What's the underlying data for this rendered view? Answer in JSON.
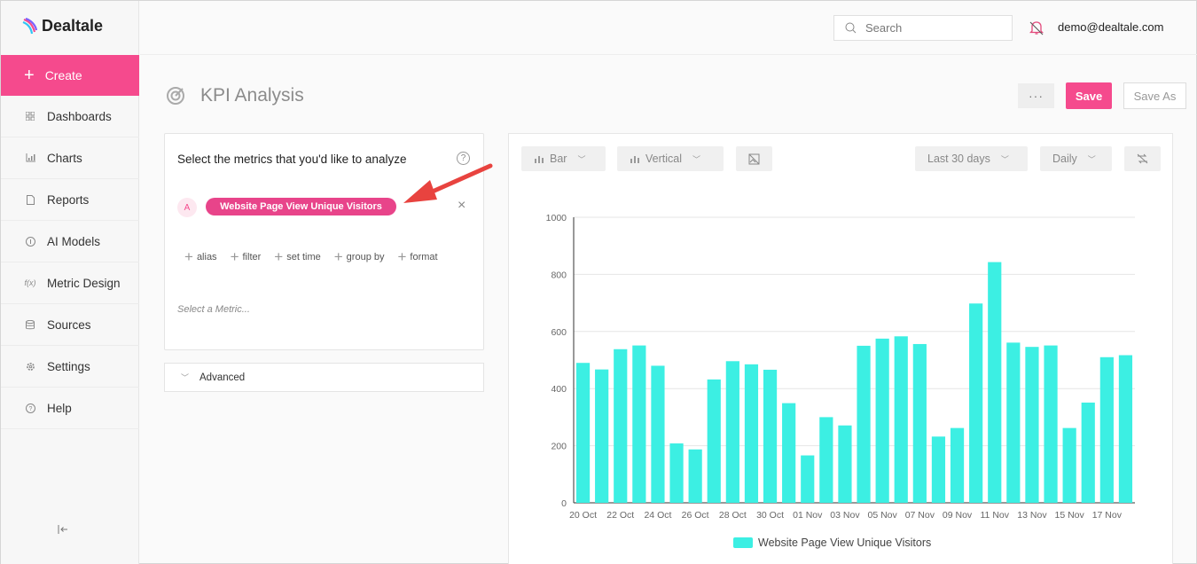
{
  "app": {
    "name": "Dealtale"
  },
  "sidebar": {
    "create_label": "Create",
    "items": [
      {
        "label": "Dashboards",
        "icon": "grid-icon"
      },
      {
        "label": "Charts",
        "icon": "bar-chart-icon"
      },
      {
        "label": "Reports",
        "icon": "document-icon"
      },
      {
        "label": "AI Models",
        "icon": "ai-icon"
      },
      {
        "label": "Metric Design",
        "icon": "function-icon",
        "icon_text": "f(x)"
      },
      {
        "label": "Sources",
        "icon": "database-icon"
      },
      {
        "label": "Settings",
        "icon": "gear-icon"
      },
      {
        "label": "Help",
        "icon": "help-icon"
      }
    ]
  },
  "header": {
    "search_placeholder": "Search",
    "user_email": "demo@dealtale.com"
  },
  "page": {
    "title": "KPI Analysis",
    "more_label": "···",
    "save_label": "Save",
    "save_as_label": "Save As"
  },
  "metrics_panel": {
    "title": "Select the metrics that you'd like to analyze",
    "metric_letter": "A",
    "metric_name": "Website Page View Unique Visitors",
    "remove_label": "×",
    "options": [
      "alias",
      "filter",
      "set time",
      "group by",
      "format"
    ],
    "select_placeholder": "Select a Metric...",
    "advanced_label": "Advanced"
  },
  "chart_toolbar": {
    "type_label": "Bar",
    "orientation_label": "Vertical",
    "range_label": "Last 30 days",
    "granularity_label": "Daily"
  },
  "colors": {
    "accent": "#f54a8d",
    "bar": "#3cefe3"
  },
  "chart_data": {
    "type": "bar",
    "title": "",
    "xlabel": "",
    "ylabel": "",
    "ylim": [
      0,
      1000
    ],
    "yticks": [
      0,
      200,
      400,
      600,
      800,
      1000
    ],
    "categories": [
      "20 Oct",
      "21 Oct",
      "22 Oct",
      "23 Oct",
      "24 Oct",
      "25 Oct",
      "26 Oct",
      "27 Oct",
      "28 Oct",
      "29 Oct",
      "30 Oct",
      "31 Oct",
      "01 Nov",
      "02 Nov",
      "03 Nov",
      "04 Nov",
      "05 Nov",
      "06 Nov",
      "07 Nov",
      "08 Nov",
      "09 Nov",
      "10 Nov",
      "11 Nov",
      "12 Nov",
      "13 Nov",
      "14 Nov",
      "15 Nov",
      "16 Nov",
      "17 Nov",
      "18 Nov"
    ],
    "xtick_labels": [
      "20 Oct",
      "22 Oct",
      "24 Oct",
      "26 Oct",
      "28 Oct",
      "30 Oct",
      "01 Nov",
      "03 Nov",
      "05 Nov",
      "07 Nov",
      "09 Nov",
      "11 Nov",
      "13 Nov",
      "15 Nov",
      "17 Nov"
    ],
    "series": [
      {
        "name": "Website Page View Unique Visitors",
        "values": [
          490,
          467,
          538,
          551,
          480,
          208,
          187,
          432,
          496,
          485,
          466,
          349,
          166,
          300,
          271,
          550,
          575,
          583,
          556,
          232,
          262,
          698,
          843,
          561,
          546,
          551,
          262,
          351,
          510,
          517
        ]
      }
    ],
    "legend": "bottom-center",
    "grid": true
  }
}
